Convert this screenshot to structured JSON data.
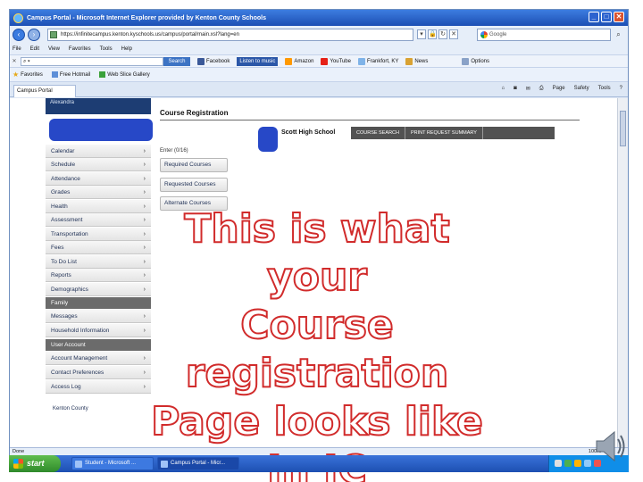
{
  "window": {
    "title": "Campus Portal - Microsoft Internet Explorer provided by Kenton County Schools",
    "url": "https://infinitecampus.kenton.kyschools.us/campus/portal/main.xsl?lang=en",
    "google_placeholder": "Google"
  },
  "menu": [
    "File",
    "Edit",
    "View",
    "Favorites",
    "Tools",
    "Help"
  ],
  "toolbar": {
    "search_label": "Search",
    "listen_label": "Listen to music",
    "chips": [
      "Facebook",
      "Amazon",
      "YouTube",
      "Frankfort, KY",
      "News",
      "Options"
    ]
  },
  "favorites": {
    "label": "Favorites",
    "items": [
      "Free Hotmail",
      "Web Slice Gallery"
    ]
  },
  "tab": {
    "label": "Campus Portal",
    "commands": [
      "Page",
      "Safety",
      "Tools"
    ]
  },
  "sidebar": {
    "header": "Alexandra",
    "items_top": [
      "Calendar",
      "Schedule",
      "Attendance",
      "Grades",
      "Health",
      "Assessment",
      "Transportation",
      "Fees",
      "To Do List",
      "Reports",
      "Demographics"
    ],
    "section_family": "Family",
    "items_family": [
      "Messages",
      "Household Information"
    ],
    "section_account": "User Account",
    "items_account": [
      "Account Management",
      "Contact Preferences",
      "Access Log"
    ],
    "footer": "Kenton County"
  },
  "main": {
    "title": "Course Registration",
    "school": "Scott High School",
    "tabs": [
      "COURSE SEARCH",
      "PRINT REQUEST SUMMARY"
    ],
    "enter_label": "Enter (0/16)",
    "buttons": [
      "Required Courses",
      "Requested Courses",
      "Alternate Courses"
    ]
  },
  "overlay": {
    "lines": [
      "This is what your",
      "Course registration",
      "Page looks like",
      "In IC"
    ],
    "color": "#d12b2b"
  },
  "status": {
    "left": "Done",
    "zoom": "100%"
  },
  "taskbar": {
    "start": "start",
    "tasks": [
      "Student - Microsoft ...",
      "Campus Portal - Micr..."
    ]
  }
}
